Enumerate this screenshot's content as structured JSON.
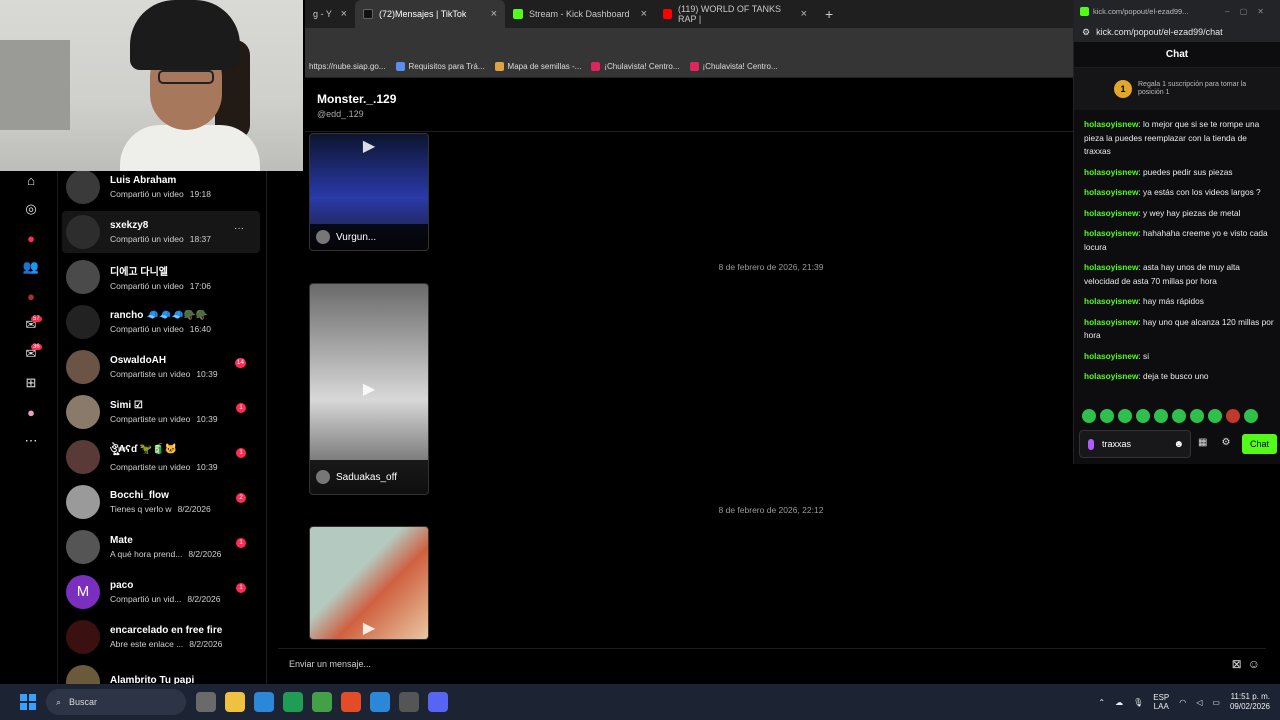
{
  "tabs": [
    {
      "title": "g - Y",
      "active": false,
      "favicon_color": "#555555"
    },
    {
      "title": "(72)Mensajes | TikTok",
      "active": true,
      "favicon_color": "#111111"
    },
    {
      "title": "Stream - Kick Dashboard",
      "active": false,
      "favicon_color": "#53fc18"
    },
    {
      "title": "(119) WORLD OF TANKS RAP |",
      "active": false,
      "favicon_color": "#ff0000"
    }
  ],
  "new_tab_label": "+",
  "close_glyph": "×",
  "bookmarks": [
    {
      "label": "https://nube.siap.go...",
      "color": "#888888"
    },
    {
      "label": "Requisitos para Trá...",
      "color": "#5a8dee"
    },
    {
      "label": "Mapa de semillas -...",
      "color": "#d9a441"
    },
    {
      "label": "¡Chulavista! Centro...",
      "color": "#e0245e"
    },
    {
      "label": "¡Chulavista! Centro...",
      "color": "#e0245e"
    }
  ],
  "rail": {
    "icons": [
      {
        "name": "home-icon",
        "glyph": "⌂"
      },
      {
        "name": "explore-icon",
        "glyph": "◎"
      },
      {
        "name": "live-icon",
        "glyph": "●"
      },
      {
        "name": "friends-icon",
        "glyph": "👥"
      },
      {
        "name": "activity-icon",
        "glyph": "●"
      },
      {
        "name": "inbox-icon",
        "glyph": "✉"
      },
      {
        "name": "messages-icon",
        "glyph": "✉"
      },
      {
        "name": "upload-icon",
        "glyph": "⊞"
      },
      {
        "name": "profile-icon",
        "glyph": "●"
      },
      {
        "name": "more-icon",
        "glyph": "⋯"
      }
    ],
    "badges": [
      {
        "text": "57"
      },
      {
        "text": "36"
      }
    ]
  },
  "conversations": [
    {
      "name": "Luis Abraham",
      "subtitle": "Compartió un video",
      "time": "19:18",
      "badge": "",
      "avatar": "#3a3a3a"
    },
    {
      "name": "sxekzy8",
      "subtitle": "Compartió un video",
      "time": "18:37",
      "badge": "",
      "avatar": "#2d2d2d",
      "hover": true
    },
    {
      "name": "디에고 다니엘",
      "subtitle": "Compartió un video",
      "time": "17:06",
      "badge": "",
      "avatar": "#4a4a4a"
    },
    {
      "name": "rancho 🧢🧢🧢🪖🪖",
      "subtitle": "Compartió un video",
      "time": "16:40",
      "badge": "",
      "avatar": "#222222"
    },
    {
      "name": "OswaldoAH",
      "subtitle": "Compartiste un video",
      "time": "10:39",
      "badge": "14",
      "avatar": "#6b5446"
    },
    {
      "name": "Simi ☑",
      "subtitle": "Compartiste un video",
      "time": "10:39",
      "badge": "1",
      "avatar": "#8a7a6a"
    },
    {
      "name": "ঔৣ₳ʕɗ 🦖🧃🐱",
      "subtitle": "Compartiste un video",
      "time": "10:39",
      "badge": "1",
      "avatar": "#5a3a36"
    },
    {
      "name": "Bocchi_flow",
      "subtitle": "Tienes q verlo w",
      "time": "8/2/2026",
      "badge": "2",
      "avatar": "#9a9a9a"
    },
    {
      "name": "Mate",
      "subtitle": "A qué hora prend...",
      "time": "8/2/2026",
      "badge": "1",
      "avatar": "#555555"
    },
    {
      "name": "paco",
      "subtitle": "Compartió un vid...",
      "time": "8/2/2026",
      "badge": "1",
      "avatar": "#7b2fbf",
      "letter": "M"
    },
    {
      "name": "encarcelado en free fire",
      "subtitle": "Abre este enlace ...",
      "time": "8/2/2026",
      "badge": "",
      "avatar": "#3a1010"
    },
    {
      "name": "Alambrito Tu papi",
      "subtitle": "",
      "time": "",
      "badge": "",
      "avatar": "#6a5a3a"
    }
  ],
  "chat": {
    "name": "Monster._.129",
    "handle": "@edd_.129",
    "dates": [
      "8 de febrero de 2026, 21:39",
      "8 de febrero de 2026, 22:12"
    ],
    "videos": [
      {
        "label": "Vurgun...",
        "colors": [
          "#0d1430",
          "#2a3aa8"
        ]
      },
      {
        "label": "Saduakas_off",
        "colors": [
          "#6a6a6a",
          "#d8d8d8"
        ]
      },
      {
        "label": "",
        "colors": [
          "#b4c9c0",
          "#d06040"
        ]
      }
    ],
    "composer_placeholder": "Enviar un mensaje..."
  },
  "kick": {
    "window_url_short": "kick.com/popout/el-ezad99...",
    "url": "kick.com/popout/el-ezad99/chat",
    "header": "Chat",
    "goal_number": "1",
    "goal_text": "Regala 1 suscripción para tomar la posición 1",
    "messages": [
      {
        "user": "holasoyisnew",
        "text": "lo mejor que si se te rompe una pieza la puedes reemplazar con la tienda de traxxas"
      },
      {
        "user": "holasoyisnew",
        "text": "puedes pedir sus piezas"
      },
      {
        "user": "holasoyisnew",
        "text": "ya estás con los videos largos ?"
      },
      {
        "user": "holasoyisnew",
        "text": "y wey hay piezas de metal"
      },
      {
        "user": "holasoyisnew",
        "text": "hahahaha creeme yo e visto cada locura"
      },
      {
        "user": "holasoyisnew",
        "text": "asta hay unos de muy alta velocidad de asta 70 millas por hora"
      },
      {
        "user": "holasoyisnew",
        "text": "hay más rápidos"
      },
      {
        "user": "holasoyisnew",
        "text": "hay uno que alcanza 120 millas por hora"
      },
      {
        "user": "holasoyisnew",
        "text": "si"
      },
      {
        "user": "holasoyisnew",
        "text": "deja te busco uno"
      }
    ],
    "emote_count": 10,
    "input_value": "traxxas",
    "chat_button": "Chat"
  },
  "taskbar": {
    "search_label": "Buscar",
    "lang_top": "ESP",
    "lang_bottom": "LAA",
    "time": "11:51 p. m.",
    "date": "09/02/2026",
    "apps": [
      "#6a6a6a",
      "#f0c040",
      "#2b88d8",
      "#1f9d55",
      "#43a047",
      "#e34c26",
      "#2b88d8",
      "#555555",
      "#5865f2"
    ]
  },
  "colors": {
    "accent_tiktok": "#fe2c55",
    "accent_kick": "#53fc18"
  }
}
